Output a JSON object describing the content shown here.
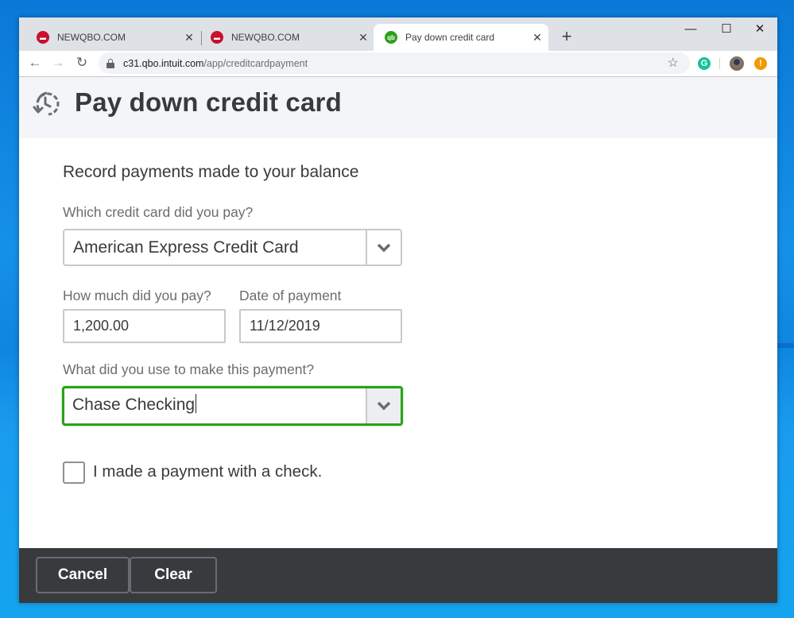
{
  "browser": {
    "tabs": [
      {
        "title": "NEWQBO.COM",
        "favicon": "newqbo-favicon",
        "active": false
      },
      {
        "title": "NEWQBO.COM",
        "favicon": "newqbo-favicon",
        "active": false
      },
      {
        "title": "Pay down credit card",
        "favicon": "quickbooks-favicon",
        "active": true
      }
    ],
    "new_tab_icon": "+",
    "close_icon": "✕",
    "window_controls": {
      "minimize": "—",
      "maximize": "☐",
      "close": "✕"
    },
    "nav": {
      "back": "←",
      "forward": "→",
      "reload": "↻"
    },
    "url": {
      "host": "c31.qbo.intuit.com",
      "path": "/app/creditcardpayment"
    },
    "bookmark_icon": "☆",
    "extensions": {
      "grammarly": "G",
      "alert": "!"
    }
  },
  "page": {
    "title": "Pay down credit card",
    "subtitle": "Record payments made to your balance",
    "credit_card": {
      "label": "Which credit card did you pay?",
      "value": "American Express Credit Card"
    },
    "amount": {
      "label": "How much did you pay?",
      "value": "1,200.00"
    },
    "date": {
      "label": "Date of payment",
      "value": "11/12/2019"
    },
    "payment_account": {
      "label": "What did you use to make this payment?",
      "value": "Chase Checking"
    },
    "check_payment": {
      "label": "I made a payment with a check.",
      "checked": false
    }
  },
  "footer": {
    "cancel_label": "Cancel",
    "clear_label": "Clear"
  },
  "colors": {
    "focus_green": "#2ca01c",
    "footer_bg": "#393a3d",
    "text_primary": "#393a3d"
  }
}
